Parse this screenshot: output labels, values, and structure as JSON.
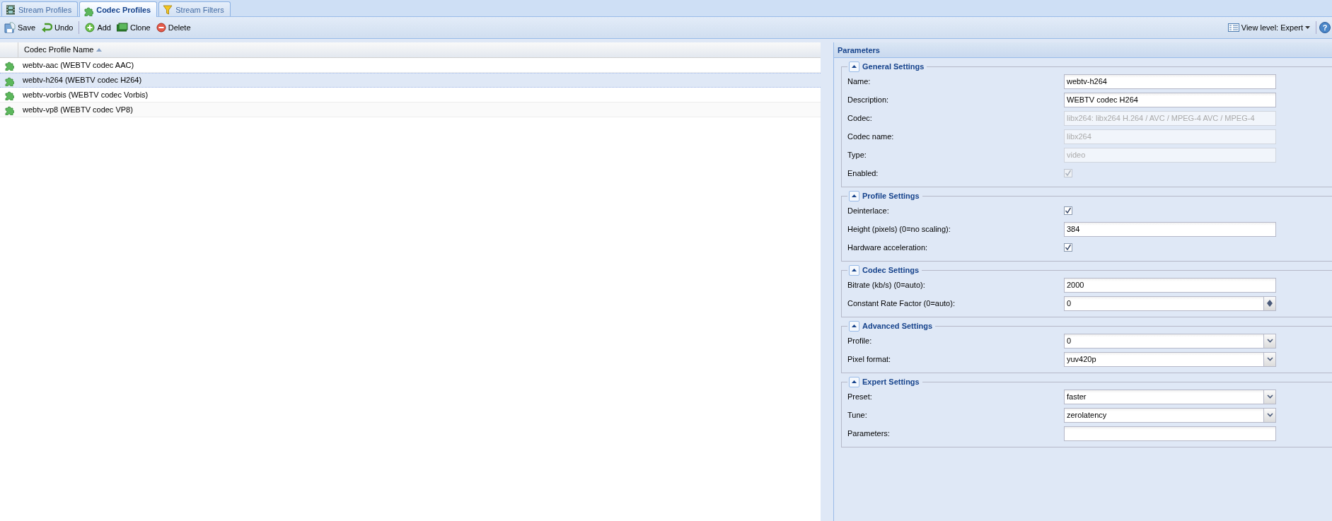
{
  "tabs": [
    {
      "label": "Stream Profiles",
      "selected": false
    },
    {
      "label": "Codec Profiles",
      "selected": true
    },
    {
      "label": "Stream Filters",
      "selected": false
    }
  ],
  "toolbar": {
    "buttons": [
      {
        "label": "Save"
      },
      {
        "label": "Undo"
      },
      {
        "label": "Add"
      },
      {
        "label": "Clone"
      },
      {
        "label": "Delete"
      }
    ],
    "view_level": "View level: Expert",
    "help": "?"
  },
  "grid": {
    "columns": [
      {
        "label": "Codec Profile Name",
        "sort_ascending": true
      }
    ],
    "rows": [
      {
        "name": "webtv-aac (WEBTV codec AAC)",
        "selected": false
      },
      {
        "name": "webtv-h264 (WEBTV codec H264)",
        "selected": true
      },
      {
        "name": "webtv-vorbis (WEBTV codec Vorbis)",
        "selected": false
      },
      {
        "name": "webtv-vp8 (WEBTV codec VP8)",
        "selected": false
      }
    ]
  },
  "parameters": {
    "title": "Parameters",
    "sections": [
      {
        "title": "General Settings",
        "expanded": true,
        "fields": [
          {
            "kind": "text",
            "label": "Name:",
            "value": "webtv-h264",
            "disabled": false
          },
          {
            "kind": "text",
            "label": "Description:",
            "value": "WEBTV codec H264",
            "disabled": false
          },
          {
            "kind": "text",
            "label": "Codec:",
            "value": "libx264: libx264 H.264 / AVC / MPEG-4 AVC / MPEG-4",
            "disabled": true
          },
          {
            "kind": "text",
            "label": "Codec name:",
            "value": "libx264",
            "disabled": true
          },
          {
            "kind": "text",
            "label": "Type:",
            "value": "video",
            "disabled": true
          },
          {
            "kind": "checkbox",
            "label": "Enabled:",
            "checked": true,
            "disabled": true
          }
        ]
      },
      {
        "title": "Profile Settings",
        "expanded": true,
        "fields": [
          {
            "kind": "checkbox",
            "label": "Deinterlace:",
            "checked": true,
            "disabled": false
          },
          {
            "kind": "text",
            "label": "Height (pixels) (0=no scaling):",
            "value": "384",
            "disabled": false
          },
          {
            "kind": "checkbox",
            "label": "Hardware acceleration:",
            "checked": true,
            "disabled": false
          }
        ]
      },
      {
        "title": "Codec Settings",
        "expanded": true,
        "fields": [
          {
            "kind": "text",
            "label": "Bitrate (kb/s) (0=auto):",
            "value": "2000",
            "disabled": false
          },
          {
            "kind": "spinner",
            "label": "Constant Rate Factor (0=auto):",
            "value": "0",
            "disabled": false
          }
        ]
      },
      {
        "title": "Advanced Settings",
        "expanded": true,
        "fields": [
          {
            "kind": "combo",
            "label": "Profile:",
            "value": "0",
            "disabled": false
          },
          {
            "kind": "combo",
            "label": "Pixel format:",
            "value": "yuv420p",
            "disabled": false
          }
        ]
      },
      {
        "title": "Expert Settings",
        "expanded": true,
        "fields": [
          {
            "kind": "combo",
            "label": "Preset:",
            "value": "faster",
            "disabled": false
          },
          {
            "kind": "combo",
            "label": "Tune:",
            "value": "zerolatency",
            "disabled": false
          },
          {
            "kind": "text",
            "label": "Parameters:",
            "disabled": false
          }
        ]
      }
    ]
  }
}
